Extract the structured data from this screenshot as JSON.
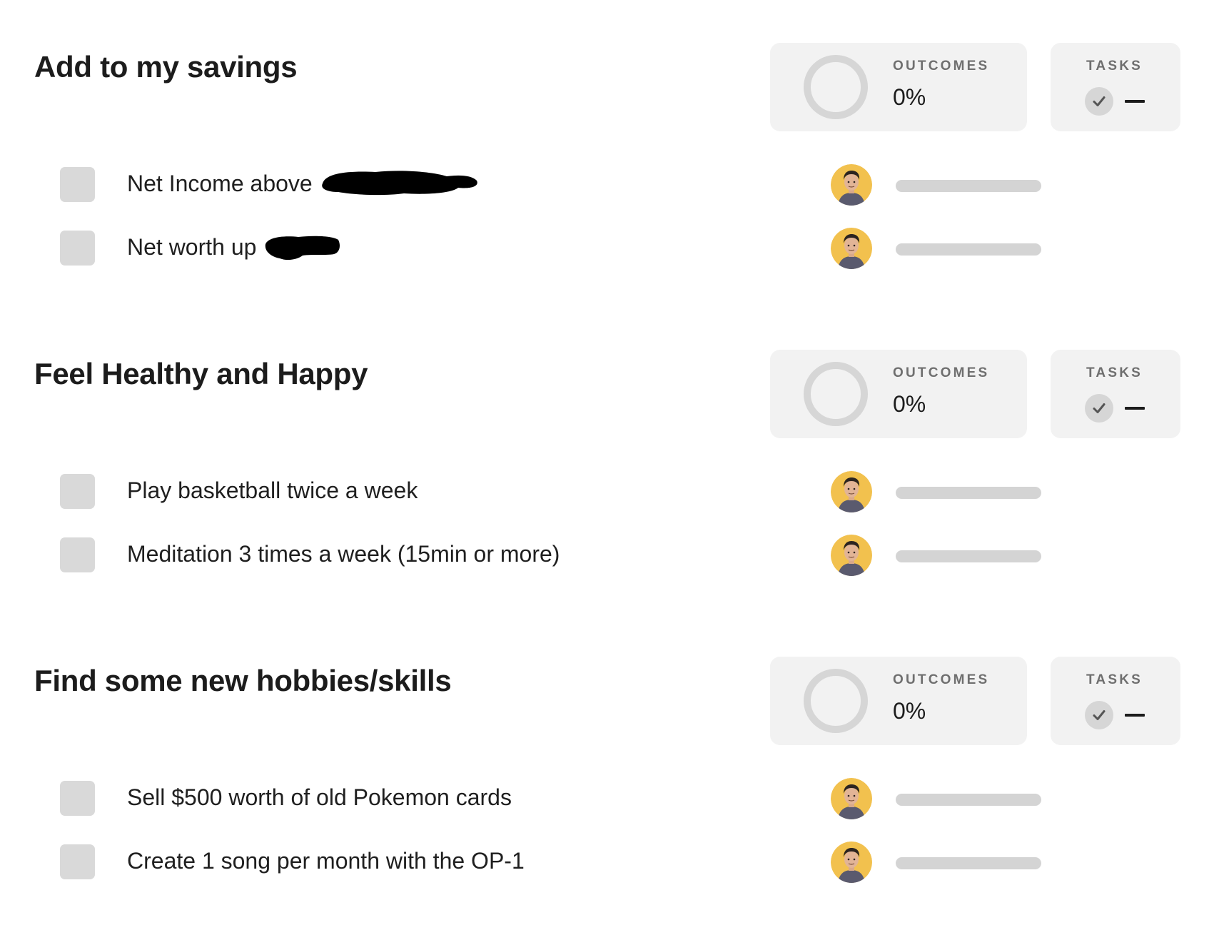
{
  "labels": {
    "outcomes": "OUTCOMES",
    "tasks": "TASKS"
  },
  "colors": {
    "card_bg": "#f2f2f2",
    "ring": "#d6d6d6",
    "checkbox": "#d9d9d9",
    "avatar_bg": "#f2c14e",
    "bar": "#d4d4d4"
  },
  "goals": [
    {
      "title": "Add to my savings",
      "outcomes_percent": "0%",
      "outcomes_progress": 0,
      "tasks_value": "—",
      "outcomes": [
        {
          "text": "Net Income above",
          "checked": false,
          "redacted": true
        },
        {
          "text": "Net worth up",
          "checked": false,
          "redacted": true
        }
      ]
    },
    {
      "title": "Feel Healthy and Happy",
      "outcomes_percent": "0%",
      "outcomes_progress": 0,
      "tasks_value": "—",
      "outcomes": [
        {
          "text": "Play basketball twice a week",
          "checked": false,
          "redacted": false
        },
        {
          "text": "Meditation 3 times a week (15min or more)",
          "checked": false,
          "redacted": false
        }
      ]
    },
    {
      "title": "Find some new hobbies/skills",
      "outcomes_percent": "0%",
      "outcomes_progress": 0,
      "tasks_value": "—",
      "outcomes": [
        {
          "text": "Sell $500 worth of old Pokemon cards",
          "checked": false,
          "redacted": false
        },
        {
          "text": "Create 1 song per month with the OP-1",
          "checked": false,
          "redacted": false
        }
      ]
    }
  ]
}
